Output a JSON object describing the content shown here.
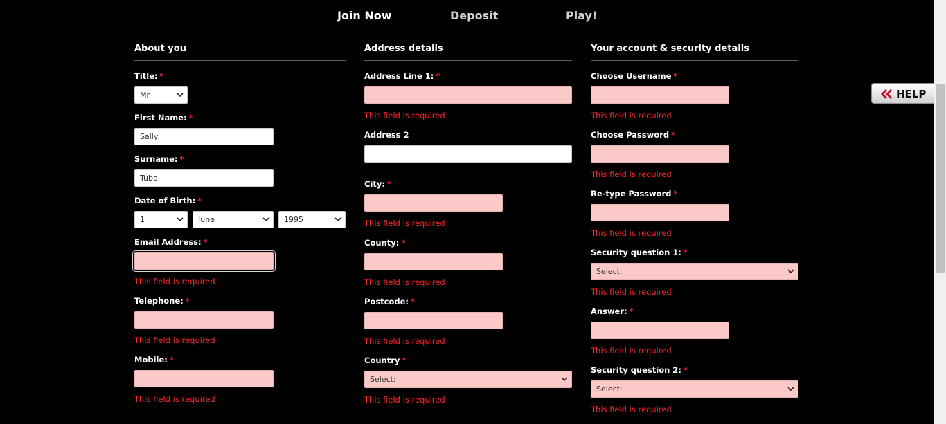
{
  "steps": [
    {
      "label": "Join Now",
      "active": true
    },
    {
      "label": "Deposit",
      "active": false
    },
    {
      "label": "Play!",
      "active": false
    }
  ],
  "about": {
    "heading": "About you",
    "title_label": "Title:",
    "title_value": "Mr",
    "first_name_label": "First Name:",
    "first_name_value": "Sally",
    "surname_label": "Surname:",
    "surname_value": "Tubo",
    "dob_label": "Date of Birth:",
    "dob_day": "1",
    "dob_month": "June",
    "dob_year": "1995",
    "email_label": "Email Address:",
    "email_value": "",
    "telephone_label": "Telephone:",
    "telephone_value": "",
    "mobile_label": "Mobile:",
    "mobile_value": ""
  },
  "address": {
    "heading": "Address details",
    "line1_label": "Address Line 1:",
    "line2_label": "Address 2",
    "city_label": "City:",
    "county_label": "County:",
    "postcode_label": "Postcode:",
    "country_label": "Country",
    "country_value": "Select:"
  },
  "account": {
    "heading": "Your account & security details",
    "username_label": "Choose Username",
    "password_label": "Choose Password",
    "retype_label": "Re-type Password",
    "sq1_label": "Security question 1:",
    "sq1_value": "Select:",
    "answer_label": "Answer:",
    "sq2_label": "Security question 2:",
    "sq2_value": "Select:"
  },
  "required_mark": "*",
  "error_text": "This field is required",
  "help": {
    "label": "HELP",
    "icon": "double-chevron-left-icon"
  },
  "colors": {
    "background": "#000000",
    "error": "#ec2a2a",
    "required": "#e01c2a",
    "invalid_field": "#fcc9c9",
    "help_icon": "#c8102e"
  }
}
